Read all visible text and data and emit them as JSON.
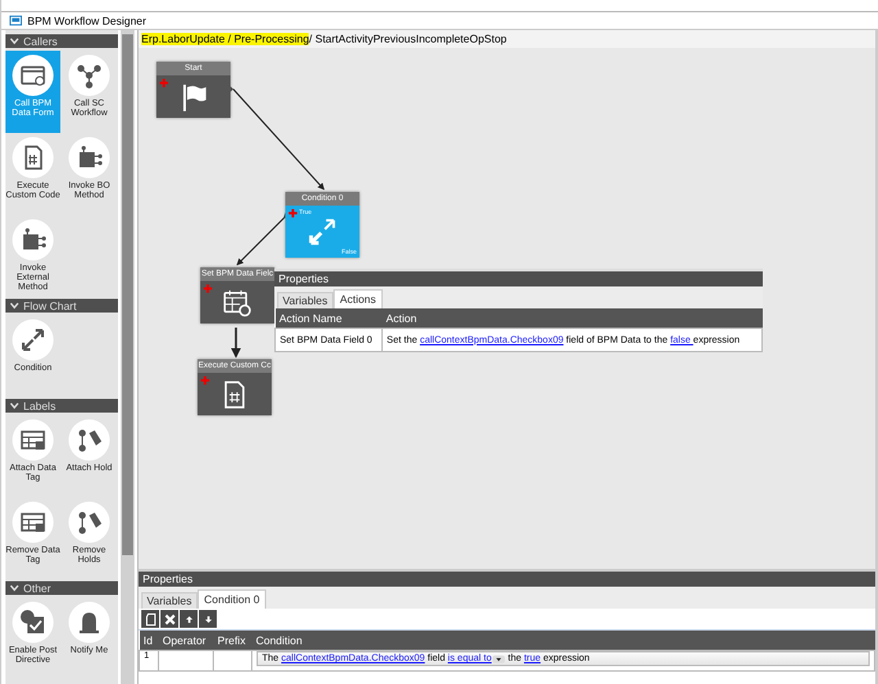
{
  "window": {
    "title": "BPM Workflow Designer"
  },
  "toolbox": [
    {
      "title": "Callers",
      "expanded": true,
      "items": [
        {
          "label": "Call BPM Data Form",
          "selected": true
        },
        {
          "label": "Call SC Workflow",
          "selected": false
        },
        {
          "label": "Execute Custom Code",
          "selected": false
        },
        {
          "label": "Invoke BO Method",
          "selected": false
        },
        {
          "label": "Invoke External Method",
          "selected": false
        }
      ]
    },
    {
      "title": "Flow Chart",
      "expanded": true,
      "items": [
        {
          "label": "Condition",
          "selected": false
        }
      ]
    },
    {
      "title": "Labels",
      "expanded": true,
      "items": [
        {
          "label": "Attach Data Tag",
          "selected": false
        },
        {
          "label": "Attach Hold",
          "selected": false
        },
        {
          "label": "Remove Data Tag",
          "selected": false
        },
        {
          "label": "Remove Holds",
          "selected": false
        }
      ]
    },
    {
      "title": "Other",
      "expanded": true,
      "items": [
        {
          "label": "Enable Post Directive",
          "selected": false
        },
        {
          "label": "Notify Me",
          "selected": false
        }
      ]
    }
  ],
  "breadcrumb": [
    {
      "text": "Erp.LaborUpdate / Pre-Processing",
      "highlighted": true
    },
    {
      "text": " / StartActivityPreviousIncompleteOpStop",
      "highlighted": false
    }
  ],
  "nodes": [
    {
      "kind": "start",
      "title": "Start",
      "selected": false
    },
    {
      "kind": "condition",
      "title": "Condition 0",
      "selected": true,
      "true_label": "True",
      "false_label": "False"
    },
    {
      "kind": "set_field",
      "title": "Set BPM Data Fielc",
      "selected": false
    },
    {
      "kind": "code",
      "title": "Execute Custom Cc",
      "selected": false
    }
  ],
  "node_properties": {
    "title": "Properties",
    "tabs": [
      {
        "label": "Variables",
        "selected": false
      },
      {
        "label": "Actions",
        "selected": true
      }
    ],
    "columns": [
      "Action Name",
      "Action"
    ],
    "rows": [
      {
        "name": "Set BPM Data Field 0",
        "action": [
          {
            "kind": "text",
            "text": "Set the "
          },
          {
            "kind": "link",
            "text": "callContextBpmData.Checkbox09"
          },
          {
            "kind": "text",
            "text": " field of BPM Data to the "
          },
          {
            "kind": "link",
            "text": " false "
          },
          {
            "kind": "text",
            "text": " expression"
          }
        ]
      }
    ]
  },
  "properties": {
    "title": "Properties",
    "tabs": [
      {
        "label": "Variables",
        "selected": false
      },
      {
        "label": "Condition 0",
        "selected": true
      }
    ],
    "columns": [
      "Id",
      "Operator",
      "Prefix",
      "Condition"
    ],
    "rows": [
      {
        "id": "1",
        "condition": [
          {
            "kind": "text",
            "text": "The "
          },
          {
            "kind": "link",
            "text": "callContextBpmData.Checkbox09"
          },
          {
            "kind": "text",
            "text": " field "
          },
          {
            "kind": "dropdown",
            "text": "is equal to"
          },
          {
            "kind": "text",
            "text": " the "
          },
          {
            "kind": "link",
            "text": " true "
          },
          {
            "kind": "text",
            "text": " expression"
          }
        ]
      }
    ]
  }
}
